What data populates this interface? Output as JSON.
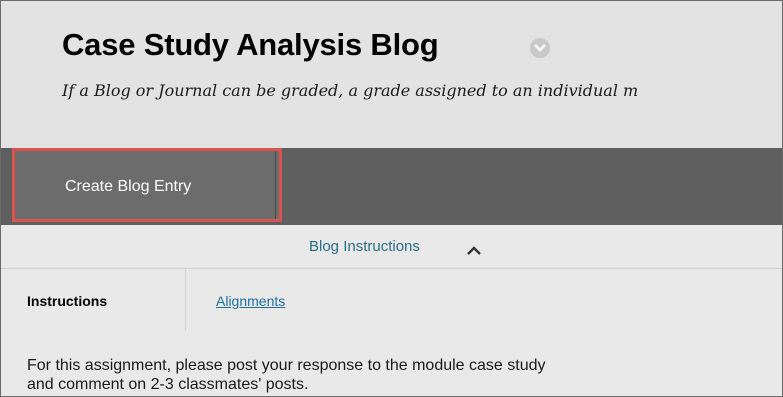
{
  "header": {
    "title": "Case Study Analysis Blog",
    "subtitle": "If a Blog or Journal can be graded, a grade assigned to an individual m"
  },
  "action_bar": {
    "create_button_label": "Create Blog Entry"
  },
  "instructions_panel": {
    "toggle_label": "Blog Instructions",
    "toggle_icon": "chevron-up-icon"
  },
  "tabs": {
    "instructions": "Instructions",
    "alignments": "Alignments"
  },
  "body": {
    "text_line_1": "For this assignment, please post your response to the module case study",
    "text_line_2": "and comment on 2-3 classmates' posts."
  },
  "colors": {
    "highlight_border": "#d9534f",
    "action_bar": "#5f5f5f",
    "link": "#1f6fa3"
  }
}
